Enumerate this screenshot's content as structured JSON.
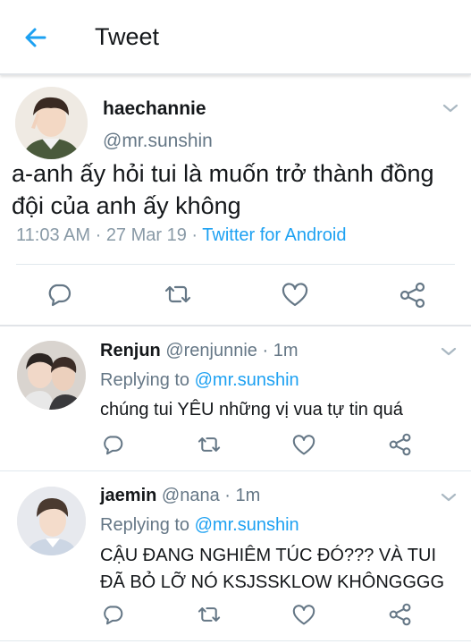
{
  "header": {
    "title": "Tweet"
  },
  "main_tweet": {
    "name": "haechannie",
    "handle": "@mr.sunshin",
    "text": "a-anh ấy hỏi tui là muốn trở thành đồng đội của anh ấy không",
    "time": "11:03 AM",
    "sep1": " · ",
    "date": "27 Mar 19",
    "sep2": " · ",
    "source": "Twitter for Android"
  },
  "replies": [
    {
      "name": "Renjun",
      "handle": "@renjunnie",
      "age": " · 1m",
      "replying_prefix": "Replying to ",
      "replying_to": "@mr.sunshin",
      "text": "chúng tui YÊU những vị vua tự tin quá"
    },
    {
      "name": "jaemin",
      "handle": "@nana",
      "age": " · 1m",
      "replying_prefix": "Replying to ",
      "replying_to": "@mr.sunshin",
      "text": "CẬU ĐANG NGHIÊM TÚC ĐÓ??? VÀ TUI ĐÃ BỎ LỠ NÓ KSJSSKLOW KHÔNGGGG"
    }
  ],
  "icons": {
    "back": "arrow-left-icon",
    "reply": "comment-bubble-icon",
    "retweet": "retweet-icon",
    "like": "heart-icon",
    "share": "share-icon",
    "more": "chevron-down-icon"
  },
  "colors": {
    "accent": "#1da1f2",
    "secondary_text": "#657786",
    "icon": "#657786"
  }
}
